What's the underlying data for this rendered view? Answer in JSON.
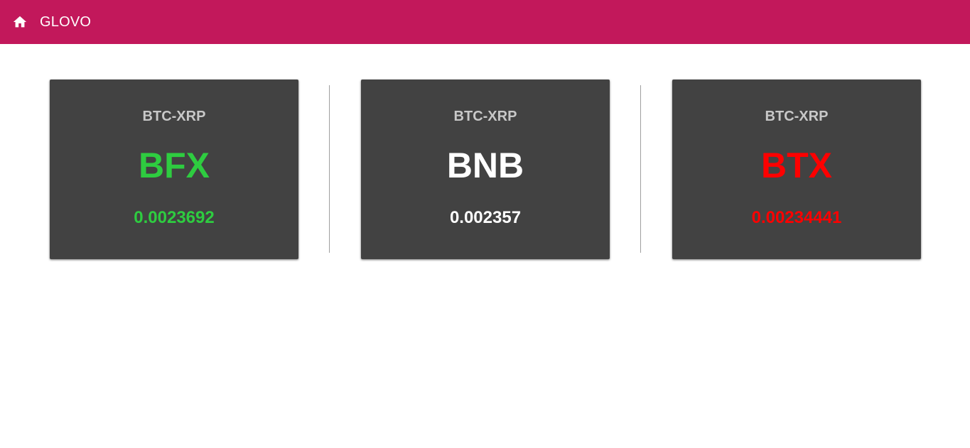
{
  "colors": {
    "appbar": "#c2185b",
    "card_bg": "#424242",
    "pair_text": "#c8c8c8",
    "up": "#2ecc40",
    "neutral": "#ffffff",
    "down": "#ff0000"
  },
  "appbar": {
    "home_icon": "home-icon",
    "title": "GLOVO"
  },
  "cards": [
    {
      "pair": "BTC-XRP",
      "exchange": "BFX",
      "price": "0.0023692",
      "status": "up"
    },
    {
      "pair": "BTC-XRP",
      "exchange": "BNB",
      "price": "0.002357",
      "status": "neutral"
    },
    {
      "pair": "BTC-XRP",
      "exchange": "BTX",
      "price": "0.00234441",
      "status": "down"
    }
  ]
}
